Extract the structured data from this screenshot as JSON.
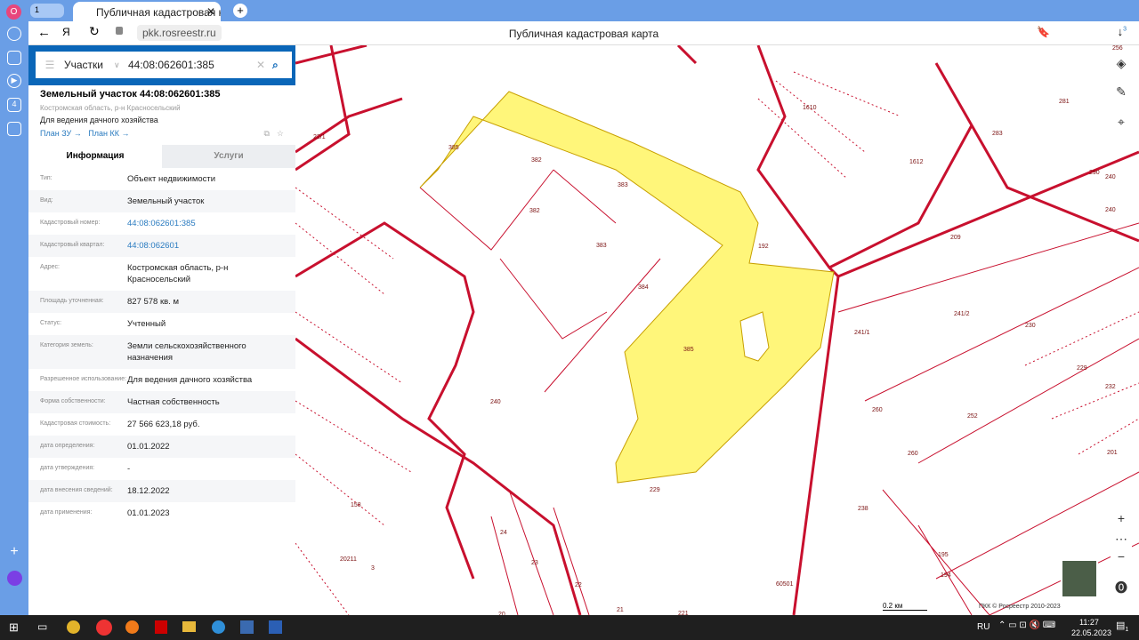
{
  "browser": {
    "profile_badge": "О",
    "tab_count": "1",
    "tab_title": "Публичная кадастровая карта",
    "url": "pkk.rosreestr.ru",
    "page_title": "Публичная кадастровая карта",
    "download_badge": "3",
    "sidebar_badge": "4"
  },
  "search": {
    "category": "Участки",
    "query": "44:08:062601:385"
  },
  "object": {
    "title": "Земельный участок 44:08:062601:385",
    "region": "Костромская область, р-н Красносельский",
    "use": "Для ведения дачного хозяйства",
    "link_plan_zu": "План ЗУ →",
    "link_plan_kk": "План КК →"
  },
  "tabs": [
    "Информация",
    "Услуги"
  ],
  "rows": [
    {
      "k": "Тип:",
      "v": "Объект недвижимости"
    },
    {
      "k": "Вид:",
      "v": "Земельный участок"
    },
    {
      "k": "Кадастровый номер:",
      "v": "44:08:062601:385",
      "link": true
    },
    {
      "k": "Кадастровый квартал:",
      "v": "44:08:062601",
      "link": true
    },
    {
      "k": "Адрес:",
      "v": "Костромская область, р-н Красносельский"
    },
    {
      "k": "Площадь уточненная:",
      "v": "827 578 кв. м"
    },
    {
      "k": "Статус:",
      "v": "Учтенный"
    },
    {
      "k": "Категория земель:",
      "v": "Земли сельскохозяйственного назначения"
    },
    {
      "k": "Разрешенное использование:",
      "v": "Для ведения дачного хозяйства"
    },
    {
      "k": "Форма собственности:",
      "v": "Частная собственность"
    },
    {
      "k": "Кадастровая стоимость:",
      "v": "27 566 623,18 руб."
    },
    {
      "k": "дата определения:",
      "v": "01.01.2022"
    },
    {
      "k": "дата утверждения:",
      "v": "-"
    },
    {
      "k": "дата внесения сведений:",
      "v": "18.12.2022"
    },
    {
      "k": "дата применения:",
      "v": "01.01.2023"
    }
  ],
  "map": {
    "labels": [
      "385",
      "382",
      "383",
      "382",
      "383",
      "384",
      "385",
      "240",
      "229",
      "209",
      "241/1",
      "241/2",
      "230",
      "260",
      "252",
      "260",
      "238",
      "195",
      "194",
      "24",
      "23",
      "22",
      "21",
      "20",
      "158",
      "20211",
      "3",
      "256",
      "281",
      "283",
      "290",
      "240",
      "240",
      "229",
      "232",
      "201",
      "1610",
      "1612",
      "192",
      "22/1",
      "60501",
      "221"
    ],
    "scale": "0.2 км",
    "copyright": "ПКК © Росреестр 2010-2023",
    "highlight_color": "#fff67a",
    "boundary_color": "#c8102e"
  },
  "taskbar": {
    "lang": "RU",
    "time": "11:27",
    "date": "22.05.2023",
    "notif": "1"
  }
}
